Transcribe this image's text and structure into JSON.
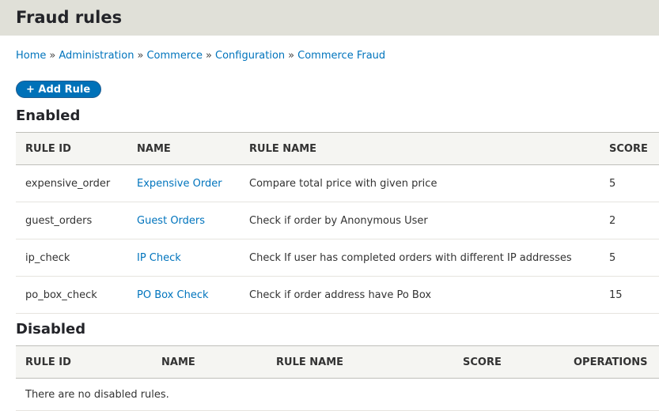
{
  "page_title": "Fraud rules",
  "breadcrumb": [
    "Home",
    "Administration",
    "Commerce",
    "Configuration",
    "Commerce Fraud"
  ],
  "breadcrumb_separator": "»",
  "add_button": "+ Add Rule",
  "enabled": {
    "heading": "Enabled",
    "columns": [
      "Rule ID",
      "Name",
      "Rule name",
      "Score"
    ],
    "rows": [
      {
        "rule_id": "expensive_order",
        "name": "Expensive Order",
        "rule_name": "Compare total price with given price",
        "score": "5"
      },
      {
        "rule_id": "guest_orders",
        "name": "Guest Orders",
        "rule_name": "Check if order by Anonymous User",
        "score": "2"
      },
      {
        "rule_id": "ip_check",
        "name": "IP Check",
        "rule_name": "Check If user has completed orders with different IP addresses",
        "score": "5"
      },
      {
        "rule_id": "po_box_check",
        "name": "PO Box Check",
        "rule_name": "Check if order address have Po Box",
        "score": "15"
      }
    ]
  },
  "disabled": {
    "heading": "Disabled",
    "columns": [
      "Rule ID",
      "Name",
      "Rule name",
      "Score",
      "Operations"
    ],
    "empty_text": "There are no disabled rules."
  },
  "colors": {
    "link": "#0074bd",
    "button": "#0071b8",
    "header_bg": "#e0e0d8"
  }
}
